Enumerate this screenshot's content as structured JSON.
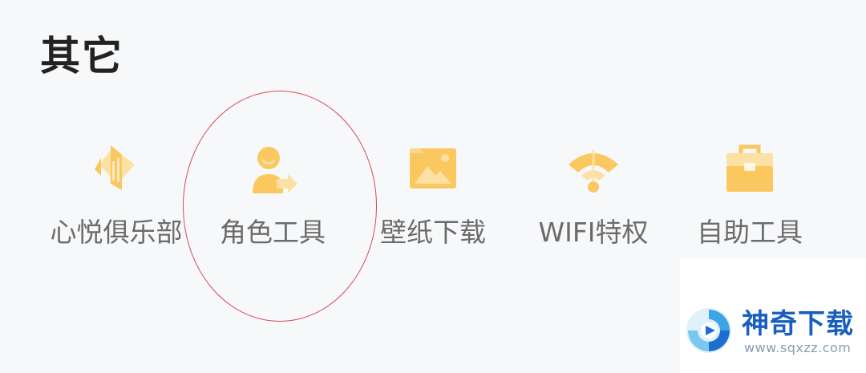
{
  "section": {
    "title": "其它"
  },
  "items": [
    {
      "label": "心悦俱乐部",
      "icon": "club-icon"
    },
    {
      "label": "角色工具",
      "icon": "role-tool-icon"
    },
    {
      "label": "壁纸下载",
      "icon": "wallpaper-icon"
    },
    {
      "label": "WIFI特权",
      "icon": "wifi-icon"
    },
    {
      "label": "自助工具",
      "icon": "toolbox-icon"
    }
  ],
  "colors": {
    "icon_main": "#fbc75f",
    "icon_light": "#fde1a4",
    "label": "#6b6b6b",
    "title": "#222222",
    "highlight": "#d64a5a",
    "watermark_brand": "#1a5fbf"
  },
  "watermark": {
    "name": "神奇下载",
    "url": "www.sqxzz.com"
  }
}
